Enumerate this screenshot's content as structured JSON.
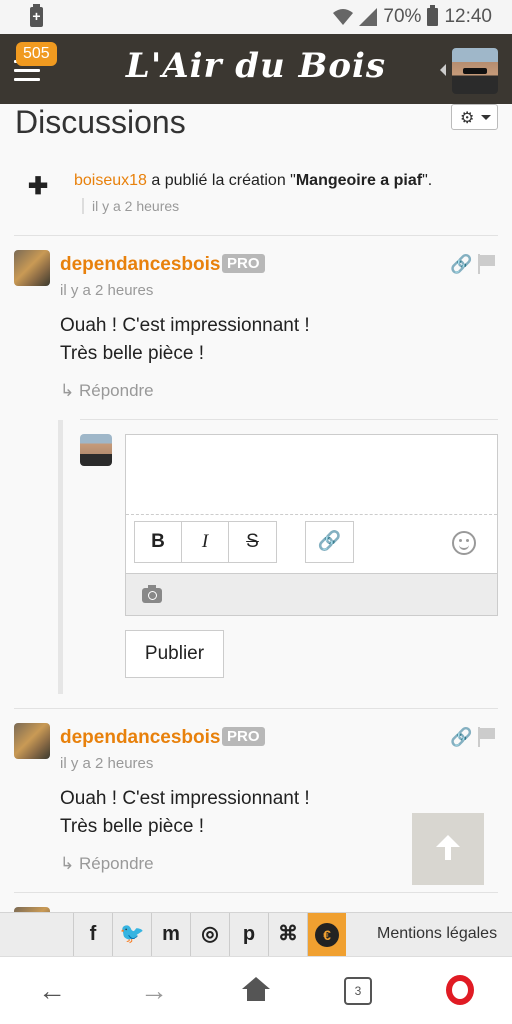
{
  "status_bar": {
    "battery": "70%",
    "time": "12:40"
  },
  "header": {
    "notification_count": "505",
    "logo": "L'Air du Bois"
  },
  "page": {
    "title": "Discussions"
  },
  "activity": {
    "user": "boiseux18",
    "action": " a publié la création \"",
    "item": "Mangeoire a piaf",
    "end": "\".",
    "time": "il y a 2 heures"
  },
  "comments": [
    {
      "author": "dependancesbois",
      "badge": "PRO",
      "time": "il y a 2 heures",
      "line1": "Ouah ! C'est impressionnant !",
      "line2": "Très belle pièce !",
      "reply": "↳ Répondre"
    },
    {
      "author": "dependancesbois",
      "badge": "PRO",
      "time": "il y a 2 heures",
      "line1": "Ouah ! C'est impressionnant !",
      "line2": "Très belle pièce !",
      "reply": "↳ Répondre"
    }
  ],
  "editor": {
    "bold": "B",
    "italic": "I",
    "strike": "S",
    "link": "🔗",
    "publish": "Publier"
  },
  "footer": {
    "social": [
      "f",
      "🐦",
      "m",
      "◎",
      "p",
      "⌘"
    ],
    "euro": "€",
    "mentions": "Mentions légales"
  },
  "navbar": {
    "back": "←",
    "forward": "→",
    "tabs_count": "3"
  }
}
